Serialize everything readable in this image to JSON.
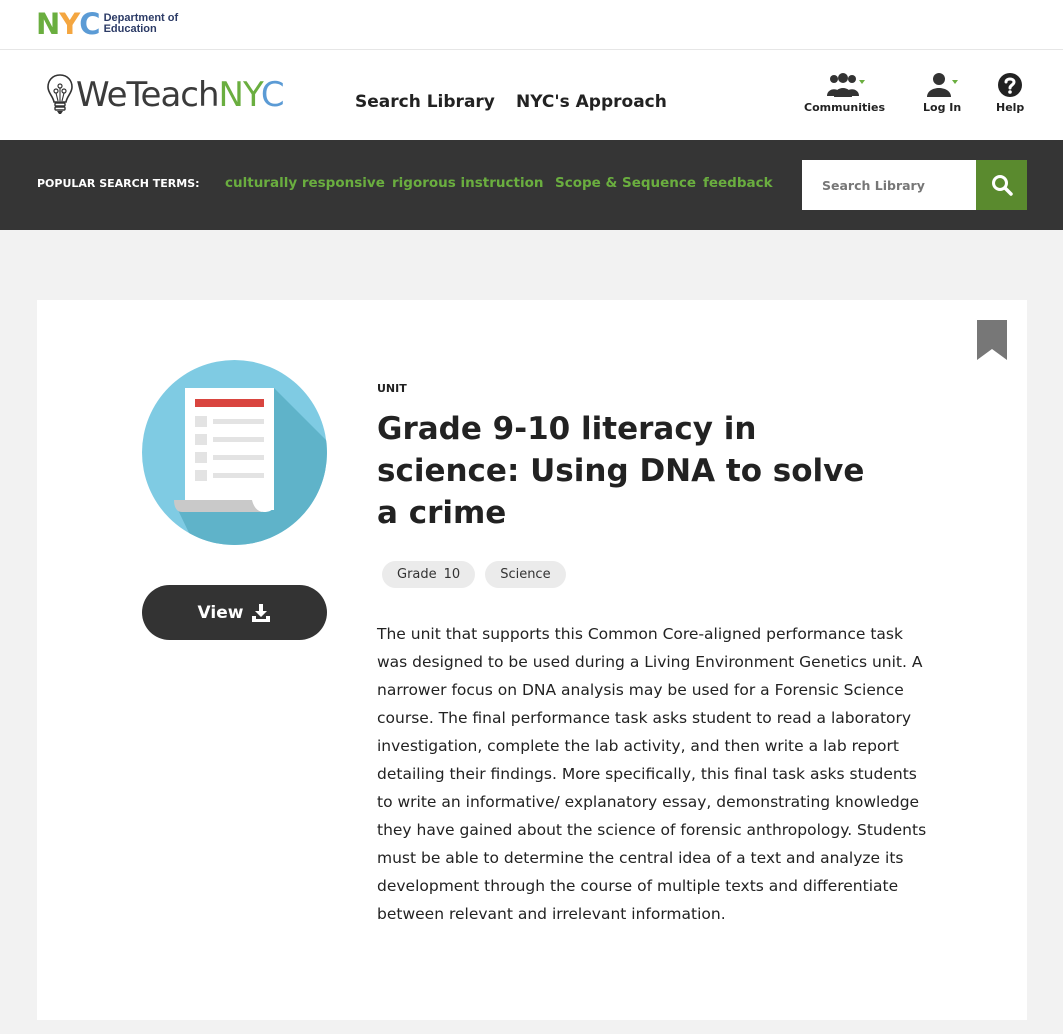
{
  "doe": {
    "letters": [
      "N",
      "Y",
      "C"
    ],
    "letter_colors": [
      "#6aae3f",
      "#f4a640",
      "#5b9bd5"
    ],
    "line1": "Department of",
    "line2": "Education"
  },
  "header": {
    "brand_we": "WeTeach",
    "brand_nyc": "NYC",
    "nav": [
      {
        "label": "Search Library"
      },
      {
        "label": "NYC's Approach"
      }
    ],
    "utilities": [
      {
        "label": "Communities",
        "icon": "people-icon"
      },
      {
        "label": "Log In",
        "icon": "user-icon"
      },
      {
        "label": "Help",
        "icon": "help-icon"
      }
    ]
  },
  "popular": {
    "label": "POPULAR SEARCH TERMS:",
    "terms": [
      "culturally responsive",
      "rigorous instruction",
      "Scope & Sequence",
      "feedback"
    ]
  },
  "search": {
    "placeholder": "Search Library",
    "icon": "search-icon"
  },
  "resource": {
    "type": "UNIT",
    "title": "Grade 9-10 literacy in science: Using DNA to solve a crime",
    "view_label": "View",
    "tags": [
      {
        "label": "Grade",
        "value": "10"
      },
      {
        "label": "Science"
      }
    ],
    "description": "The unit that supports this Common Core-aligned performance task was designed to be used during a Living Environment Genetics unit. A narrower focus on DNA analysis may be used for a Forensic Science course. The final performance task asks student to read a laboratory investigation, complete the lab activity, and then write a lab report detailing their findings. More specifically, this final task asks students to write an informative/ explanatory essay, demonstrating knowledge they have gained about the science of forensic anthropology. Students must be able to determine the central idea of a text and analyze its development through the course of multiple texts and differentiate between relevant and irrelevant information."
  },
  "colors": {
    "green": "#6aae3f",
    "dark_green": "#5a8a2e",
    "blue": "#5b9bd5",
    "dark_bar": "#353535",
    "icon_circle": "#7fcbe3"
  }
}
